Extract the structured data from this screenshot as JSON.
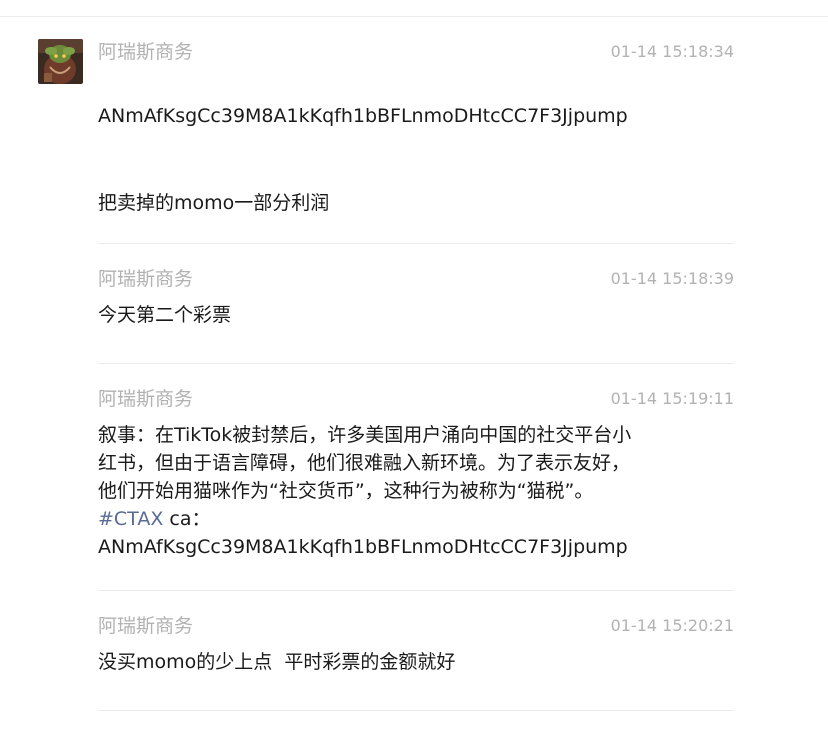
{
  "messages": [
    {
      "sender": "阿瑞斯商务",
      "time": "01-14 15:18:34",
      "lines": [
        "ANmAfKsgCc39M8A1kKqfh1bBFLnmoDHtcCC7F3Jjpump",
        "把卖掉的momo一部分利润"
      ]
    },
    {
      "sender": "阿瑞斯商务",
      "time": "01-14 15:18:39",
      "lines": [
        "今天第二个彩票"
      ]
    },
    {
      "sender": "阿瑞斯商务",
      "time": "01-14 15:19:11",
      "lines": [
        "叙事：在TikTok被封禁后，许多美国用户涌向中国的社交平台小",
        "红书，但由于语言障碍，他们很难融入新环境。为了表示友好，",
        "他们开始用猫咪作为“社交货币”，这种行为被称为“猫税”。",
        "ANmAfKsgCc39M8A1kKqfh1bBFLnmoDHtcCC7F3Jjpump"
      ],
      "hashtag": "#CTAX",
      "hashtag_suffix": " ca："
    },
    {
      "sender": "阿瑞斯商务",
      "time": "01-14 15:20:21",
      "lines": [
        "没买momo的少上点  平时彩票的金额就好"
      ]
    }
  ],
  "colors": {
    "meta": "#b2b2b2",
    "text": "#1a1a1a",
    "hashtag": "#576b95",
    "divider": "#ececec"
  }
}
